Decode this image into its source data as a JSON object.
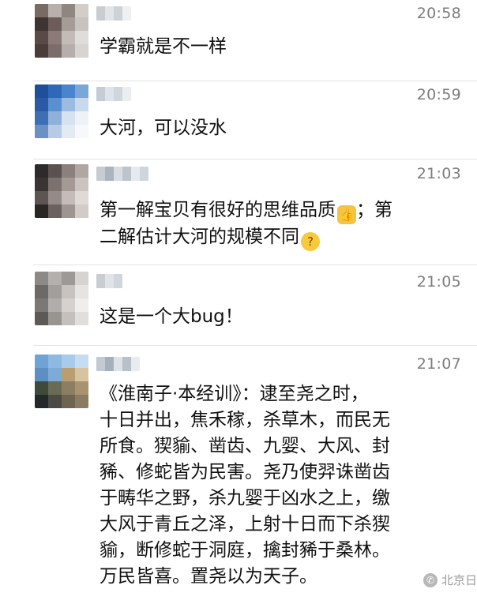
{
  "messages": [
    {
      "time": "20:58",
      "lines": [
        "学霸就是不一样"
      ],
      "avatar_colors": [
        "#7a6a66",
        "#b7b0ab",
        "#8f8581",
        "#d2cdc9",
        "#3e3434",
        "#6d5d59",
        "#a59c98",
        "#c9c3bf",
        "#5a4a47",
        "#8b7b77",
        "#c2bbb7",
        "#e0dcd9",
        "#4a3c39",
        "#7b6d69",
        "#b5aeaa",
        "#d8d4d1"
      ],
      "name_colors": [
        "#c9cdd2",
        "#e2e5e8",
        "#cdd2d6",
        "#eef0f2"
      ]
    },
    {
      "time": "20:59",
      "lines": [
        "大河，可以没水"
      ],
      "avatar_colors": [
        "#1f4f9a",
        "#2f68b8",
        "#4a84cc",
        "#7aa6d8",
        "#2a5aa6",
        "#5a8fd0",
        "#9bbbe0",
        "#c8d9ee",
        "#3d6fb5",
        "#8fb0d9",
        "#d6e2ef",
        "#eef2f7",
        "#6a90c4",
        "#b7cbe4",
        "#e3eaf3",
        "#f6f8fa"
      ],
      "name_colors": [
        "#c5ccd6",
        "#dfe4ea",
        "#cfd6de",
        "#ebeef1"
      ]
    },
    {
      "time": "21:03",
      "lines": [
        "第一解宝贝有很好的思维品质",
        "；第",
        "二解估计大河的规模不同"
      ],
      "emoji_1": "thumbs-up-emoji",
      "emoji_2": "thinking-face-emoji",
      "avatar_colors": [
        "#2e2a2a",
        "#5a5250",
        "#8a807c",
        "#b0a7a3",
        "#3a3434",
        "#7c716d",
        "#a49995",
        "#cbc3bf",
        "#5e5553",
        "#958a86",
        "#c4bcb8",
        "#e0dad7",
        "#2b2626",
        "#6b615e",
        "#9e9490",
        "#d2cbc8"
      ],
      "name_colors": [
        "#c7ccd3",
        "#aab3be",
        "#d8dde3",
        "#bcc4cd",
        "#e6e9ed",
        "#cfd5dc"
      ]
    },
    {
      "time": "21:05",
      "lines": [
        "这是一个大bug！"
      ],
      "avatar_colors": [
        "#8d8986",
        "#b4b0ad",
        "#9d9996",
        "#d6d3d1",
        "#6d6966",
        "#a29e9b",
        "#c6c3c1",
        "#e6e4e3",
        "#7c7875",
        "#b1adaa",
        "#d4d1cf",
        "#efeeed",
        "#5d5956",
        "#98948f",
        "#c3c0bd",
        "#e1dfdd"
      ],
      "name_colors": [
        "#c8cdd4",
        "#e0e4e9",
        "#d0d6dc"
      ]
    },
    {
      "time": "21:07",
      "lines": [
        "《淮南子·本经训》：逮至尧之时，",
        "十日并出，焦禾稼，杀草木，而民无",
        "所食。猰貐、凿齿、九婴、大风、封",
        "豨、修蛇皆为民害。尧乃使羿诛凿齿",
        "于畴华之野，杀九婴于凶水之上，缴",
        "大风于青丘之泽，上射十日而下杀猰",
        "貐，断修蛇于洞庭，擒封豨于桑林。",
        "万民皆喜。置尧以为天子。"
      ],
      "avatar_colors": [
        "#6fa3d6",
        "#8db9e3",
        "#a9cbeb",
        "#c6ddf1",
        "#5d8fc2",
        "#7eaad6",
        "#b99e72",
        "#d6c4a0",
        "#3f4a3a",
        "#6a6b55",
        "#8c7e60",
        "#a89270",
        "#25282a",
        "#4b4a44",
        "#6d6452",
        "#8a7c62"
      ],
      "name_colors": [
        "#c3cad3",
        "#a6b0bc",
        "#dde2e8",
        "#b8c0ca",
        "#e8ebef"
      ]
    }
  ],
  "watermark": {
    "text": "北京日",
    "icon": "wechat-logo-icon"
  }
}
